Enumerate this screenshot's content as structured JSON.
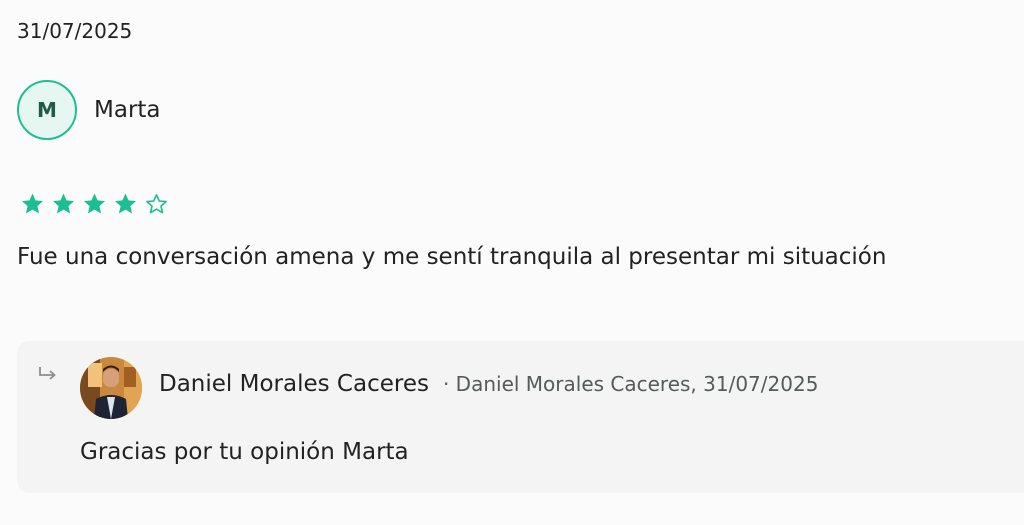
{
  "review": {
    "date": "31/07/2025",
    "reviewer_initial": "M",
    "reviewer_name": "Marta",
    "rating": 4,
    "rating_max": 5,
    "text": "Fue una conversación amena y me sentí tranquila al presentar mi situación"
  },
  "reply": {
    "author_name": "Daniel Morales Caceres",
    "meta": "· Daniel Morales Caceres, 31/07/2025",
    "text": "Gracias por tu opinión Marta"
  },
  "colors": {
    "accent": "#1cbf91",
    "avatar_bg": "#e6f6f0",
    "reply_bg": "#f3f4f3"
  }
}
